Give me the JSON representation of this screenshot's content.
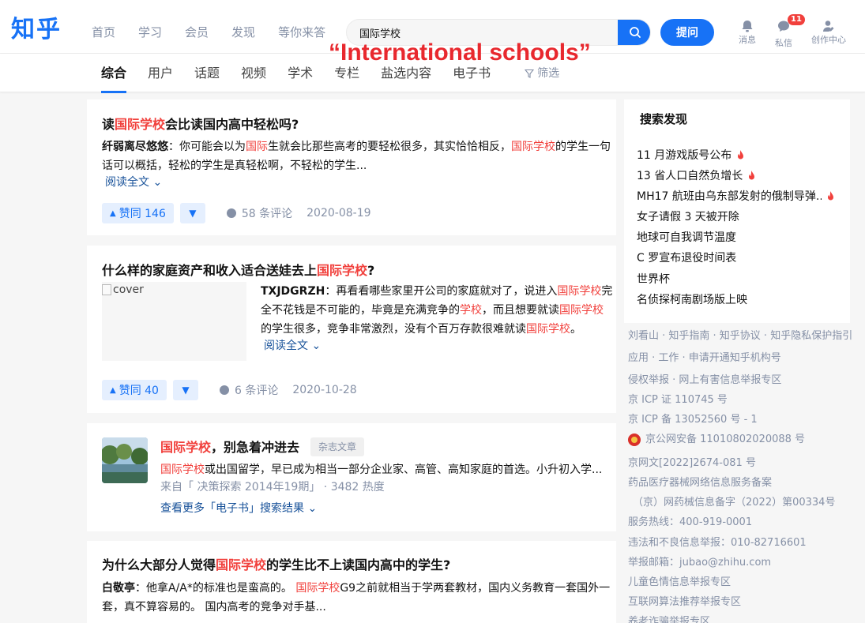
{
  "header": {
    "logo": "知乎",
    "nav": [
      "首页",
      "学习",
      "会员",
      "发现",
      "等你来答"
    ],
    "search_value": "国际学校",
    "ask_label": "提问",
    "icons": [
      {
        "name": "bell-icon",
        "label": "消息"
      },
      {
        "name": "chat-icon",
        "label": "私信",
        "badge": "11"
      },
      {
        "name": "creator-icon",
        "label": "创作中心"
      }
    ]
  },
  "caption": "“International schools”",
  "tabs": {
    "items": [
      "综合",
      "用户",
      "话题",
      "视频",
      "学术",
      "专栏",
      "盐选内容",
      "电子书"
    ],
    "active": "综合",
    "filter_label": "筛选"
  },
  "results": [
    {
      "title_pre": "读",
      "title_hl": "国际学校",
      "title_post": "会比读国内高中轻松吗?",
      "author": "纤弱离尽悠悠",
      "line1_a": "：你可能会以为",
      "line1_hl1": "国际",
      "line1_b": "生就会比那些高考的要轻松很多，其实恰恰相反，",
      "line1_hl2": "国际学校",
      "line1_c": "的学生一句",
      "line2": "话可以概括，轻松的学生是真轻松啊，不轻松的学生...",
      "read_more": "阅读全文",
      "votes": "赞同 146",
      "comments": "58 条评论",
      "date": "2020-08-19"
    },
    {
      "title_pre": "什么样的家庭资产和收入适合送娃去上",
      "title_hl": "国际学校",
      "title_post": "?",
      "cover_alt": "cover",
      "author": "TXJDGRZH",
      "l1_a": "：再看看哪些家里开公司的家庭就对了，说进入",
      "l1_hl": "国际学校",
      "l1_b": "完",
      "l2_a": "全不花钱是不可能的，毕竟是充满竞争的",
      "l2_hl1": "学校",
      "l2_b": "，而且想要就读",
      "l2_hl2": "国际学校",
      "l3_a": "的学生很多，竞争非常激烈，没有个百万存款很难就读",
      "l3_hl": "国际学校",
      "l3_b": "。",
      "read_more": "阅读全文",
      "votes": "赞同 40",
      "comments": "6 条评论",
      "date": "2020-10-28"
    },
    {
      "title_hl": "国际学校",
      "title_post": "，别急着冲进去",
      "tag": "杂志文章",
      "desc_hl": "国际学校",
      "desc": "或出国留学，早已成为相当一部分企业家、高管、高知家庭的首选。小升初入学...",
      "source": "来自「 决策探索 2014年19期」 · 3482 热度",
      "more": "查看更多「电子书」搜索结果"
    },
    {
      "title_pre": "为什么大部分人觉得",
      "title_hl": "国际学校",
      "title_post": "的学生比不上读国内高中的学生?",
      "author": "白敬亭",
      "l1_a": "：他拿A/A*的标准也是蛮高的。 ",
      "l1_hl": "国际学校",
      "l1_b": "G9之前就相当于学两套教材，国内义务教育一套国外一",
      "l2": "套，真不算容易的。 国内高考的竞争对手基..."
    }
  ],
  "sidebar": {
    "title": "搜索发现",
    "items": [
      {
        "text": "11 月游戏版号公布",
        "hot": true
      },
      {
        "text": "13 省人口自然负增长",
        "hot": true
      },
      {
        "text": "MH17 航班由乌东部发射的俄制导弹...",
        "hot": true
      },
      {
        "text": "女子请假 3 天被开除",
        "hot": false
      },
      {
        "text": "地球可自我调节温度",
        "hot": false
      },
      {
        "text": "C 罗宣布退役时间表",
        "hot": false
      },
      {
        "text": "世界杯",
        "hot": false
      },
      {
        "text": "名侦探柯南剧场版上映",
        "hot": false
      }
    ],
    "footer": [
      "刘看山 · 知乎指南 · 知乎协议 · 知乎隐私保护指引",
      "应用 · 工作 · 申请开通知乎机构号",
      "侵权举报 · 网上有害信息举报专区",
      "京 ICP 证 110745 号",
      "京 ICP 备 13052560 号 - 1",
      "京公网安备 11010802020088 号",
      "京网文[2022]2674-081 号",
      "药品医疗器械网络信息服务备案",
      "（京）网药械信息备字（2022）第00334号",
      "服务热线：400-919-0001",
      "违法和不良信息举报：010-82716601",
      "举报邮箱：jubao@zhihu.com",
      "儿童色情信息举报专区",
      "互联网算法推荐举报专区",
      "养老诈骗举报专区"
    ]
  },
  "colors": {
    "brand": "#1772f6",
    "highlight": "#f1403c",
    "link": "#175199",
    "caption": "#e8282e"
  }
}
